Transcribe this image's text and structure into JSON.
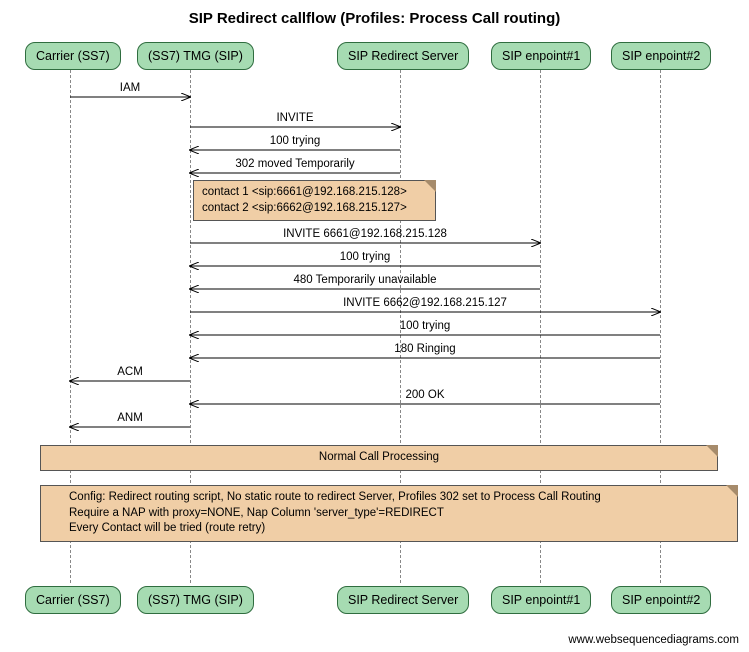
{
  "chart_data": {
    "type": "sequence",
    "title": "SIP Redirect callflow (Profiles: Process Call routing)",
    "actors": [
      "Carrier (SS7)",
      "(SS7) TMG (SIP)",
      "SIP Redirect Server",
      "SIP enpoint#1",
      "SIP enpoint#2"
    ],
    "messages": [
      {
        "from": "Carrier (SS7)",
        "to": "(SS7) TMG (SIP)",
        "label": "IAM"
      },
      {
        "from": "(SS7) TMG (SIP)",
        "to": "SIP Redirect Server",
        "label": "INVITE"
      },
      {
        "from": "SIP Redirect Server",
        "to": "(SS7) TMG (SIP)",
        "label": "100 trying"
      },
      {
        "from": "SIP Redirect Server",
        "to": "(SS7) TMG (SIP)",
        "label": "302 moved Temporarily"
      },
      {
        "note_over": "(SS7) TMG (SIP)",
        "label": "contact 1 <sip:6661@192.168.215.128>\ncontact 2 <sip:6662@192.168.215.127>"
      },
      {
        "from": "(SS7) TMG (SIP)",
        "to": "SIP enpoint#1",
        "label": "INVITE 6661@192.168.215.128"
      },
      {
        "from": "SIP enpoint#1",
        "to": "(SS7) TMG (SIP)",
        "label": "100 trying"
      },
      {
        "from": "SIP enpoint#1",
        "to": "(SS7) TMG (SIP)",
        "label": "480 Temporarily unavailable"
      },
      {
        "from": "(SS7) TMG (SIP)",
        "to": "SIP enpoint#2",
        "label": "INVITE 6662@192.168.215.127"
      },
      {
        "from": "SIP enpoint#2",
        "to": "(SS7) TMG (SIP)",
        "label": "100 trying"
      },
      {
        "from": "SIP enpoint#2",
        "to": "(SS7) TMG (SIP)",
        "label": "180 Ringing"
      },
      {
        "from": "(SS7) TMG (SIP)",
        "to": "Carrier (SS7)",
        "label": "ACM"
      },
      {
        "from": "SIP enpoint#2",
        "to": "(SS7) TMG (SIP)",
        "label": "200 OK"
      },
      {
        "from": "(SS7) TMG (SIP)",
        "to": "Carrier (SS7)",
        "label": "ANM"
      },
      {
        "note_over_all": true,
        "label": "Normal Call Processing"
      },
      {
        "note_over_all": true,
        "label": "Config: Redirect routing script, No static route to redirect Server, Profiles 302 set to Process Call Routing\nRequire a NAP with proxy=NONE, Nap Column 'server_type'=REDIRECT\nEvery Contact will be tried (route retry)"
      }
    ]
  },
  "title": "SIP Redirect callflow (Profiles: Process Call routing)",
  "actors": {
    "a0": "Carrier (SS7)",
    "a1": "(SS7) TMG (SIP)",
    "a2": "SIP Redirect Server",
    "a3": "SIP enpoint#1",
    "a4": "SIP enpoint#2"
  },
  "msg": {
    "m0": "IAM",
    "m1": "INVITE",
    "m2": "100 trying",
    "m3": "302 moved Temporarily",
    "m4a": "contact 1 <sip:6661@192.168.215.128>",
    "m4b": "contact 2 <sip:6662@192.168.215.127>",
    "m5": "INVITE 6661@192.168.215.128",
    "m6": "100 trying",
    "m7": "480 Temporarily unavailable",
    "m8": "INVITE 6662@192.168.215.127",
    "m9": "100 trying",
    "m10": "180 Ringing",
    "m11": "ACM",
    "m12": "200 OK",
    "m13": "ANM"
  },
  "notes": {
    "n1": "Normal Call Processing",
    "n2a": "Config: Redirect routing script, No static route to redirect Server, Profiles 302 set to Process Call Routing",
    "n2b": "Require a NAP with proxy=NONE, Nap Column 'server_type'=REDIRECT",
    "n2c": "Every Contact will be tried (route retry)"
  },
  "footer": "www.websequencediagrams.com"
}
